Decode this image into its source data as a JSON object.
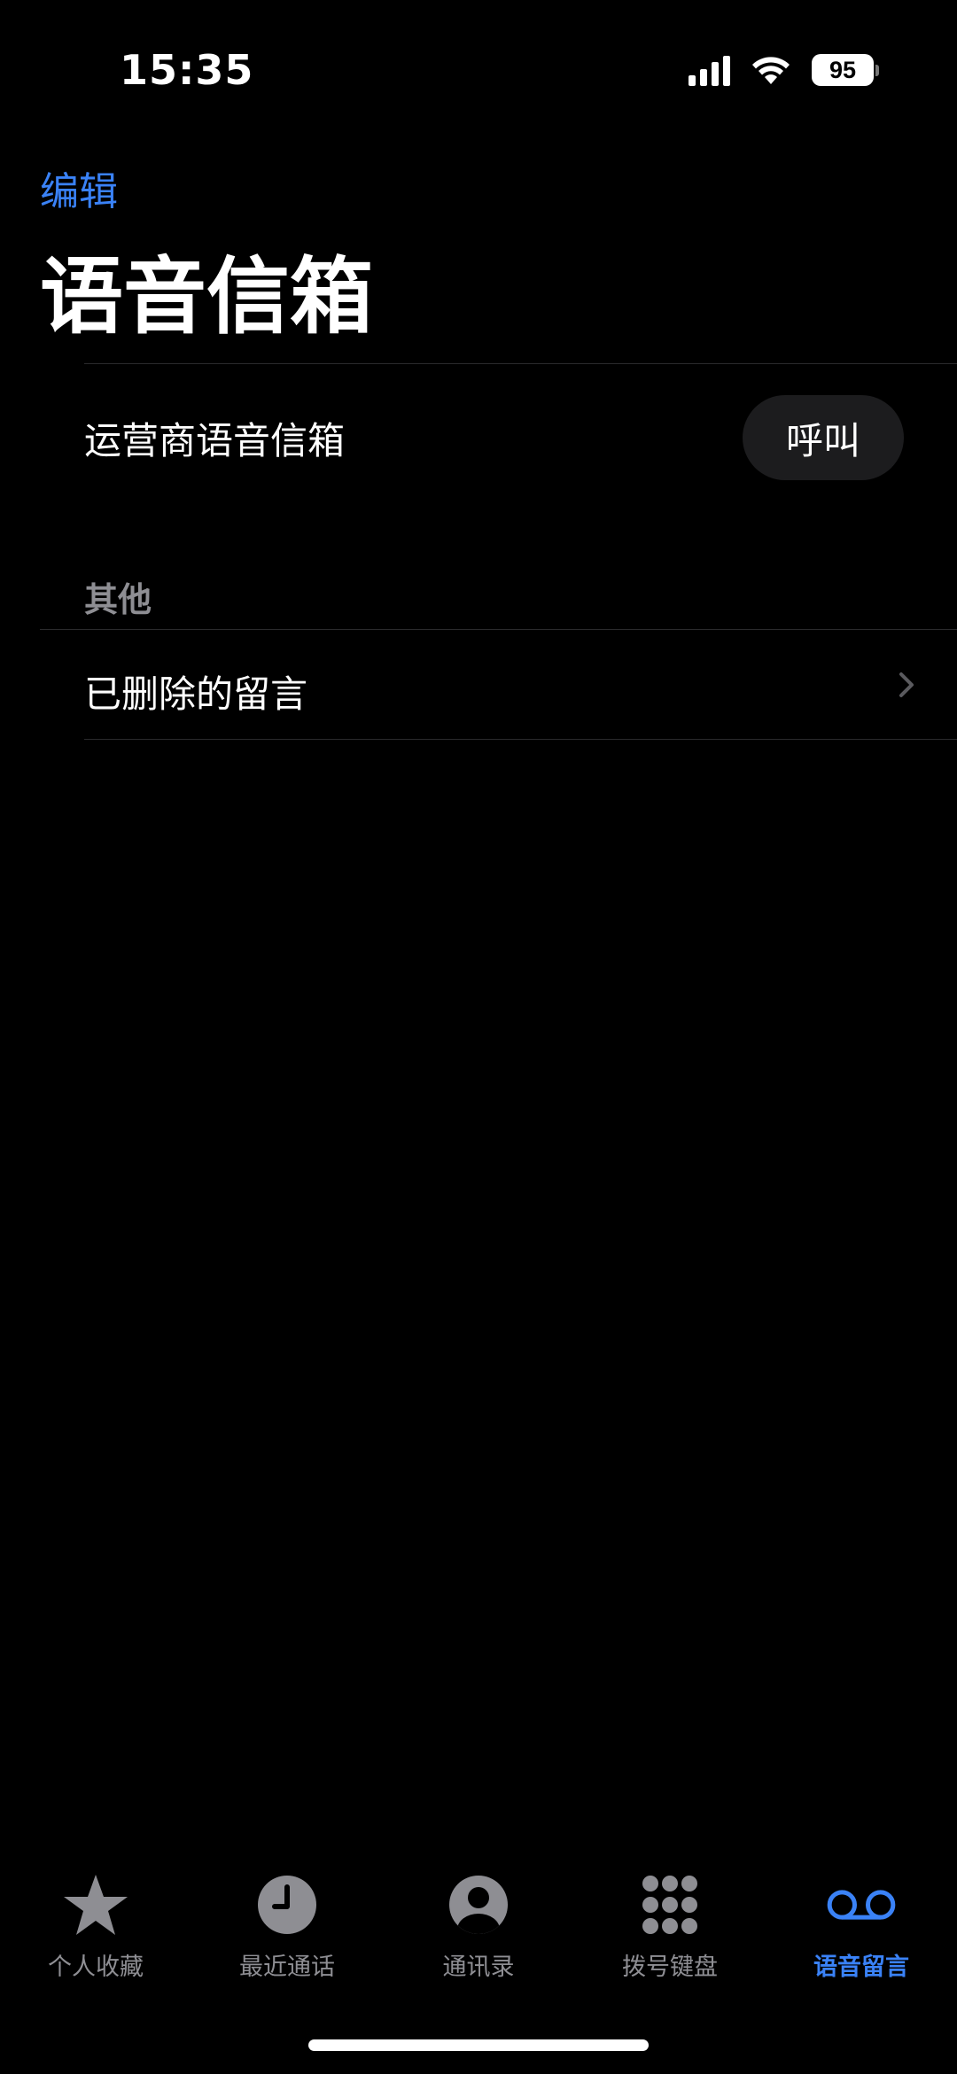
{
  "status_bar": {
    "time": "15:35",
    "battery": "95",
    "icons": [
      "signal-icon",
      "wifi-icon",
      "battery-icon"
    ]
  },
  "header": {
    "edit_label": "编辑",
    "title": "语音信箱"
  },
  "carrier_voicemail": {
    "label": "运营商语音信箱",
    "call_label": "呼叫"
  },
  "other_section": {
    "header": "其他",
    "deleted_label": "已删除的留言"
  },
  "tabbar": {
    "tabs": [
      {
        "label": "个人收藏",
        "icon": "star-icon",
        "active": false
      },
      {
        "label": "最近通话",
        "icon": "clock-icon",
        "active": false
      },
      {
        "label": "通讯录",
        "icon": "person-icon",
        "active": false
      },
      {
        "label": "拨号键盘",
        "icon": "keypad-icon",
        "active": false
      },
      {
        "label": "语音留言",
        "icon": "voicemail-icon",
        "active": true
      }
    ]
  },
  "colors": {
    "accent": "#3a82f7",
    "background": "#000000",
    "inactive_tab": "#8e8e93",
    "button_bg": "#1c1c1e"
  }
}
